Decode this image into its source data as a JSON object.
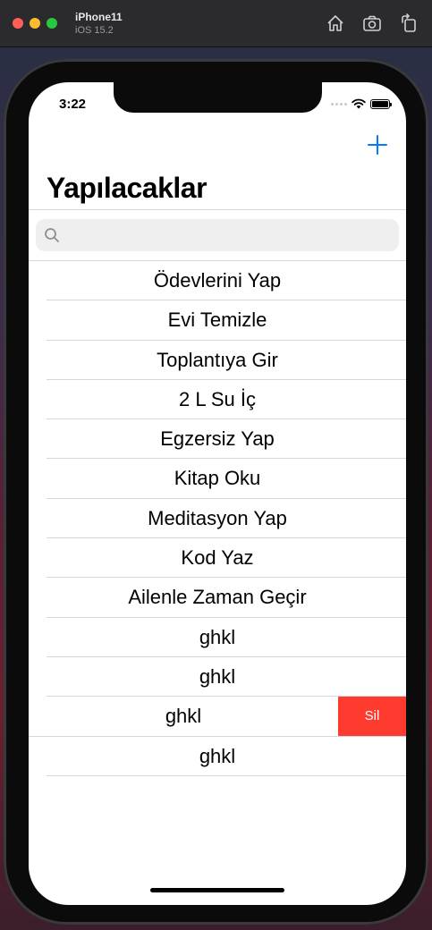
{
  "window": {
    "device_name": "iPhone11",
    "os_version": "iOS 15.2",
    "toolbar_icons": [
      "home-icon",
      "screenshot-icon",
      "rotate-icon"
    ]
  },
  "status_bar": {
    "time": "3:22"
  },
  "nav": {
    "title": "Yapılacaklar",
    "add_icon": "plus-icon"
  },
  "search": {
    "placeholder": ""
  },
  "todos": [
    "Ödevlerini Yap",
    "Evi Temizle",
    "Toplantıya Gir",
    "2 L Su İç",
    "Egzersiz Yap",
    "Kitap Oku",
    "Meditasyon Yap",
    "Kod Yaz",
    "Ailenle Zaman Geçir",
    "ghkl",
    "ghkl",
    "ghkl",
    "ghkl"
  ],
  "swipe_action": {
    "label": "Sil",
    "color": "#ff3b30"
  },
  "colors": {
    "accent": "#007aff"
  }
}
